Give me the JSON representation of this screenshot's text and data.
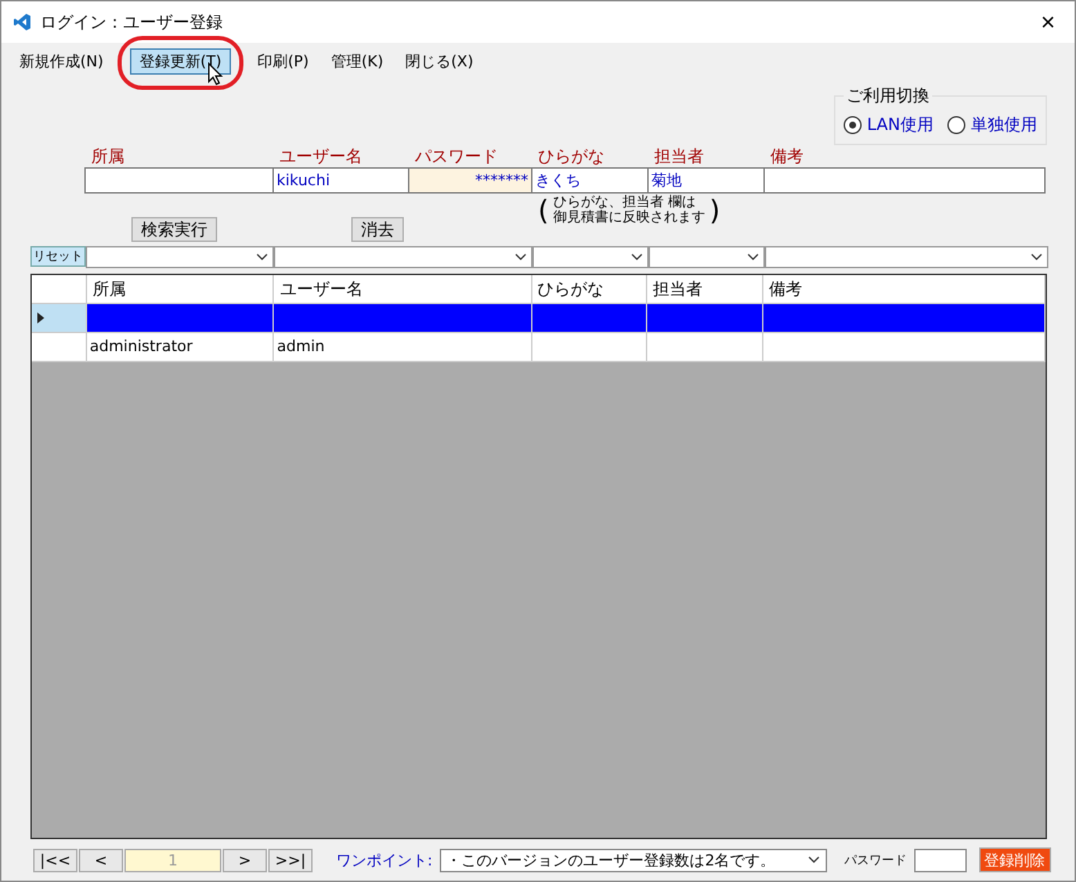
{
  "window": {
    "title": "ログイン：ユーザー登録",
    "close": "×"
  },
  "menu": [
    {
      "label": "新規作成(N)",
      "selected": false
    },
    {
      "label": "登録更新(T)",
      "selected": true
    },
    {
      "label": "印刷(P)",
      "selected": false
    },
    {
      "label": "管理(K)",
      "selected": false
    },
    {
      "label": "閉じる(X)",
      "selected": false
    }
  ],
  "usage": {
    "title": "ご利用切換",
    "options": [
      {
        "label": "LAN使用",
        "selected": true
      },
      {
        "label": "単独使用",
        "selected": false
      }
    ]
  },
  "form": [
    {
      "label": "所属"
    },
    {
      "label": "ユーザー名",
      "value": "kikuchi"
    },
    {
      "label": "パスワード",
      "value": "*******",
      "kind": "password"
    },
    {
      "label": "ひらがな",
      "value": "きくち"
    },
    {
      "label": "担当者",
      "value": "菊地"
    },
    {
      "label": "備考"
    }
  ],
  "note": {
    "open": "(",
    "lines": [
      "ひらがな、担当者 欄は",
      "御見積書に反映されます"
    ],
    "close": ")"
  },
  "search_button": "検索実行",
  "clear_button": "消去",
  "reset_button": "リセット",
  "table": {
    "columns": [
      "所属",
      "ユーザー名",
      "ひらがな",
      "担当者",
      "備考"
    ],
    "rows": [
      {
        "cells": [
          "",
          "",
          "",
          "",
          ""
        ],
        "selected": true
      },
      {
        "cells": [
          "administrator",
          "admin",
          "",
          "",
          ""
        ],
        "selected": false
      }
    ]
  },
  "footer": {
    "nav": [
      "|<<",
      "<",
      "1",
      ">",
      ">>|"
    ],
    "tip_label": "ワンポイント:",
    "tip": "・このバージョンのユーザー登録数は2名です。",
    "password_label": "パスワード",
    "delete_button": "登録削除"
  }
}
